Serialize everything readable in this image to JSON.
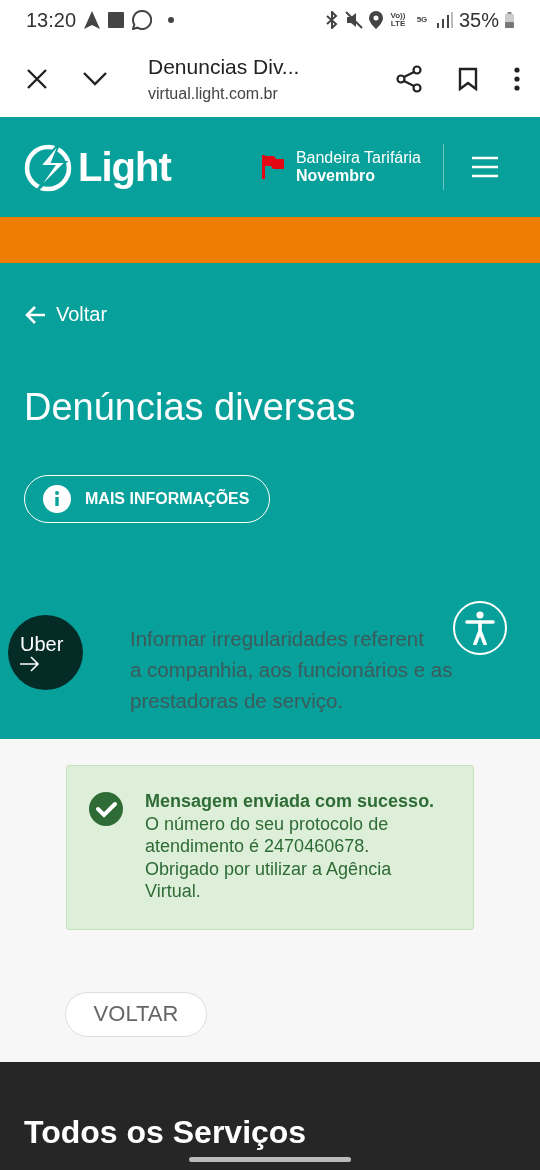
{
  "status_bar": {
    "time": "13:20",
    "volte_label": "Vo)) LTE",
    "network_label": "5G",
    "battery": "35%"
  },
  "browser_bar": {
    "page_title": "Denuncias Div...",
    "url": "virtual.light.com.br"
  },
  "header": {
    "logo_text": "Light",
    "flag_label": "Bandeira Tarifária",
    "flag_month": "Novembro"
  },
  "hero": {
    "back_link": "Voltar",
    "title": "Denúncias diversas",
    "info_button": "MAIS INFORMAÇÕES",
    "uber_badge": "Uber",
    "description_lines": [
      "Informar irregularidades referent",
      "a companhia, aos funcionários e as",
      "prestadoras de serviço."
    ]
  },
  "success_message": {
    "title": "Mensagem enviada com sucesso.",
    "body": "O número do seu protocolo de atendimento é 2470460678. Obrigado por utilizar a Agência Virtual."
  },
  "back_button": "VOLTAR",
  "footer": {
    "heading": "Todos os Serviços"
  }
}
